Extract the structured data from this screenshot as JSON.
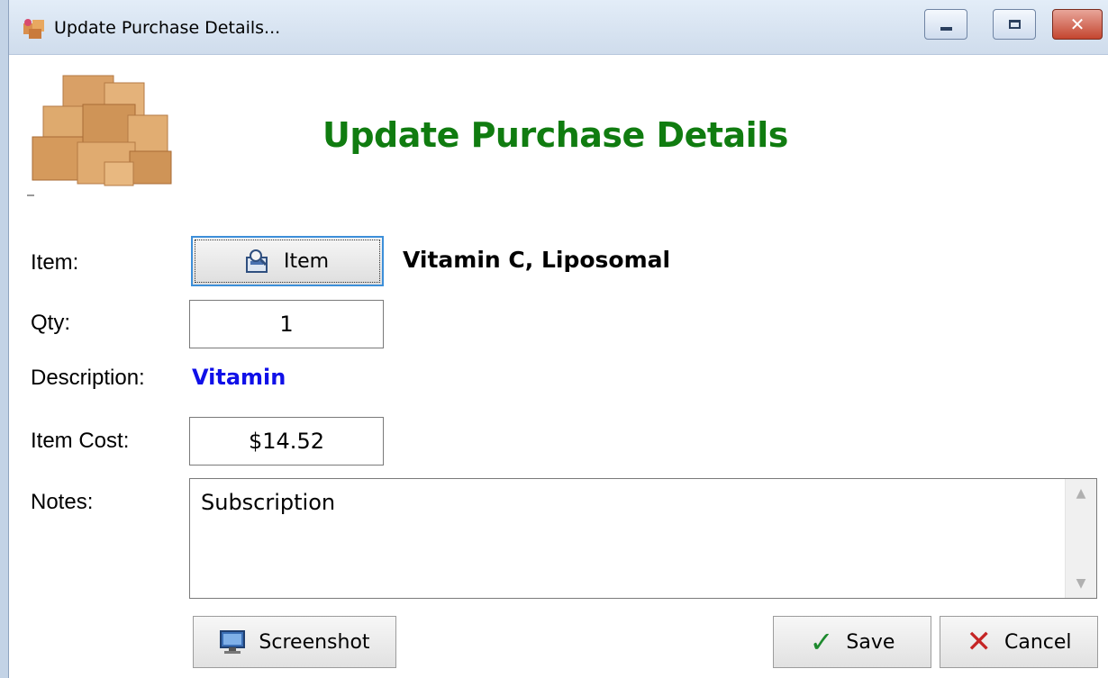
{
  "window": {
    "title": "Update Purchase Details...",
    "controls": {
      "minimize_icon": "minimize-icon",
      "maximize_icon": "maximize-icon",
      "close_glyph": "✕"
    }
  },
  "header": {
    "title": "Update Purchase Details",
    "title_color": "#107c10",
    "logo": "boxes-logo"
  },
  "form": {
    "item_label": "Item:",
    "item_button_label": "Item",
    "item_name": "Vitamin C, Liposomal",
    "qty_label": "Qty:",
    "qty_value": "1",
    "description_label": "Description:",
    "description_value": "Vitamin",
    "description_color": "#1010e8",
    "item_cost_label": "Item Cost:",
    "item_cost_value": "$14.52",
    "notes_label": "Notes:",
    "notes_value": "Subscription"
  },
  "buttons": {
    "screenshot": "Screenshot",
    "save": "Save",
    "cancel": "Cancel",
    "save_glyph": "✓",
    "cancel_glyph": "✕"
  }
}
